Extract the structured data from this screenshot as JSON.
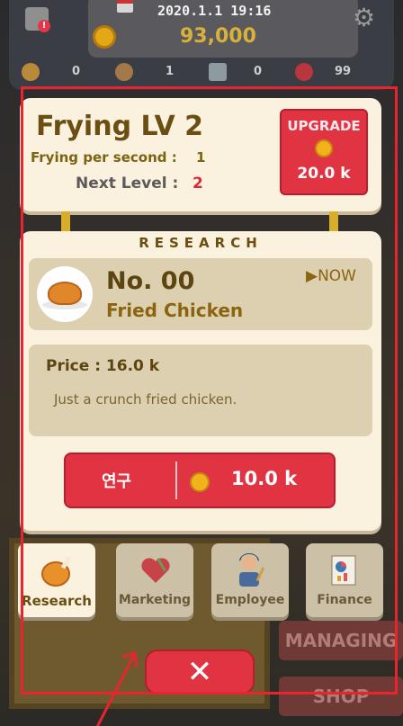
{
  "hud": {
    "datetime": "2020.1.1 19:16",
    "money": "93,000",
    "stats": [
      "0",
      "1",
      "0",
      "99"
    ]
  },
  "level_card": {
    "title": "Frying LV 2",
    "fps_label": "Frying per second :",
    "fps_value": "1",
    "next_label": "Next Level :",
    "next_value": "2",
    "upgrade": {
      "title": "UPGRADE",
      "price": "20.0 k"
    }
  },
  "research": {
    "title": "RESEARCH",
    "item": {
      "number": "No. 00",
      "name": "Fried Chicken",
      "status": "▶NOW"
    },
    "price_label": "Price : 16.0 k",
    "description": "Just a crunch fried chicken.",
    "button": {
      "label": "연구",
      "price": "10.0 k"
    }
  },
  "tabs": [
    {
      "label": "Research",
      "active": true,
      "icon": "fried-chicken-icon"
    },
    {
      "label": "Marketing",
      "active": false,
      "icon": "heart-marketing-icon"
    },
    {
      "label": "Employee",
      "active": false,
      "icon": "employee-icon"
    },
    {
      "label": "Finance",
      "active": false,
      "icon": "finance-chart-icon"
    }
  ],
  "background": {
    "managing": "MANAGING",
    "shop": "SHOP"
  },
  "close_label": "✕",
  "colors": {
    "accent_red": "#e03443",
    "card_bg": "#fbf1df",
    "title_brown": "#6a4e12",
    "gold": "#f2b21a"
  }
}
